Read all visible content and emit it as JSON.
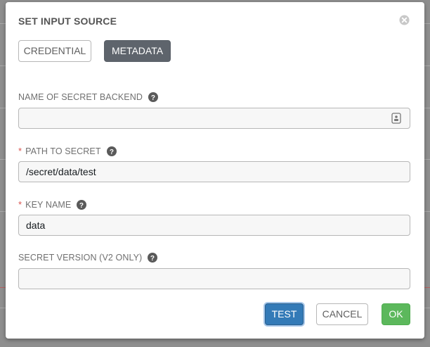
{
  "dialog": {
    "title": "SET INPUT SOURCE",
    "close_icon": "close-circle-icon"
  },
  "tabs": [
    {
      "label": "CREDENTIAL",
      "selected": false
    },
    {
      "label": "METADATA",
      "selected": true
    }
  ],
  "fields": {
    "secret_backend": {
      "label": "NAME OF SECRET BACKEND",
      "required": false,
      "value": "",
      "help_icon": "question-circle-icon",
      "trailing_icon": "lookup-icon"
    },
    "path": {
      "label": "PATH TO SECRET",
      "required": true,
      "value": "/secret/data/test",
      "help_icon": "question-circle-icon"
    },
    "key": {
      "label": "KEY NAME",
      "required": true,
      "value": "data",
      "help_icon": "question-circle-icon"
    },
    "version": {
      "label": "SECRET VERSION (V2 ONLY)",
      "required": false,
      "value": "",
      "help_icon": "question-circle-icon"
    }
  },
  "required_marker": "*",
  "buttons": {
    "test": "TEST",
    "cancel": "CANCEL",
    "ok": "OK"
  },
  "colors": {
    "primary": "#337ab7",
    "success": "#5cb85c",
    "active_tab": "#5e646c",
    "required": "#d9534f"
  }
}
